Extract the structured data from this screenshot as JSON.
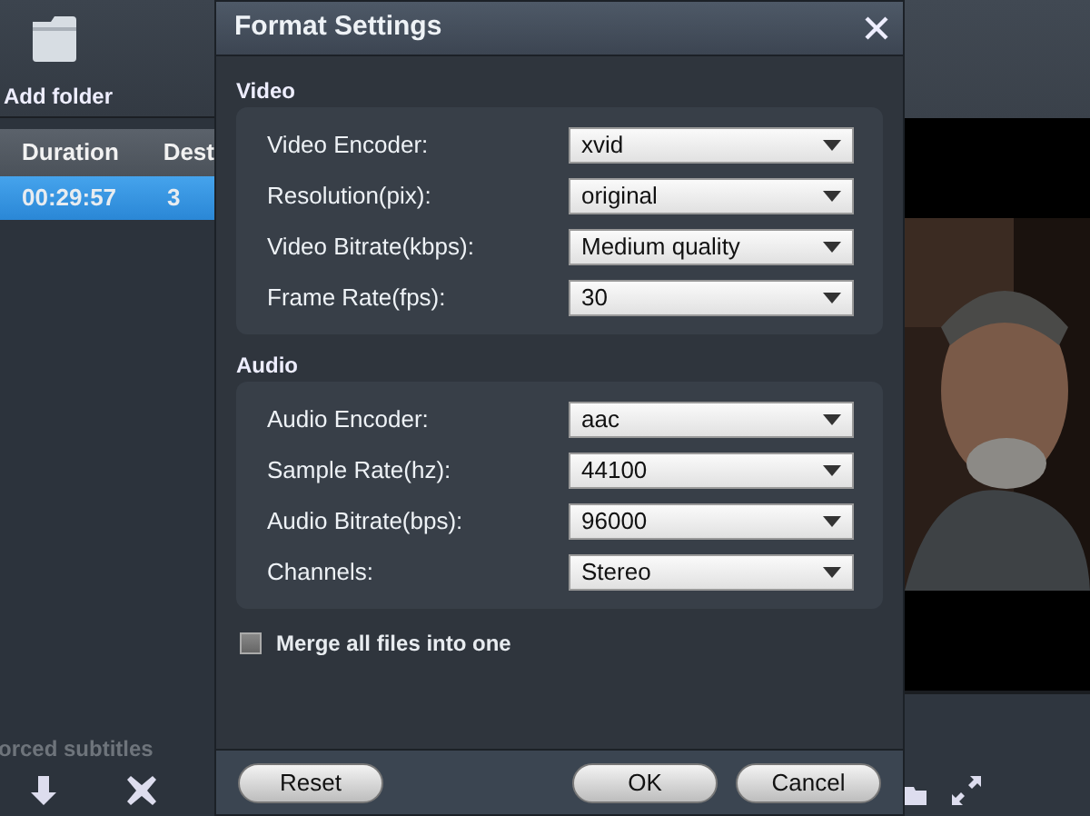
{
  "app": {
    "add_folder": "Add folder",
    "table": {
      "columns": [
        "Duration",
        "Dest"
      ],
      "rows": [
        {
          "cells": [
            "00:29:57",
            "3"
          ],
          "selected": true
        }
      ]
    },
    "subtitle_label": "orced subtitles"
  },
  "dialog": {
    "title": "Format Settings",
    "groups": [
      {
        "title": "Video",
        "settings": [
          {
            "label": "Video Encoder:",
            "value": "xvid"
          },
          {
            "label": "Resolution(pix):",
            "value": "original"
          },
          {
            "label": "Video Bitrate(kbps):",
            "value": "Medium quality"
          },
          {
            "label": "Frame Rate(fps):",
            "value": "30"
          }
        ]
      },
      {
        "title": "Audio",
        "settings": [
          {
            "label": "Audio Encoder:",
            "value": "aac"
          },
          {
            "label": "Sample Rate(hz):",
            "value": "44100"
          },
          {
            "label": "Audio Bitrate(bps):",
            "value": "96000"
          },
          {
            "label": "Channels:",
            "value": "Stereo"
          }
        ]
      }
    ],
    "merge": {
      "label": "Merge all files into one",
      "checked": false
    },
    "buttons": [
      {
        "label": "Reset",
        "kind": "secondary"
      },
      {
        "label": "OK",
        "kind": "primary"
      },
      {
        "label": "Cancel",
        "kind": "primary"
      }
    ]
  }
}
